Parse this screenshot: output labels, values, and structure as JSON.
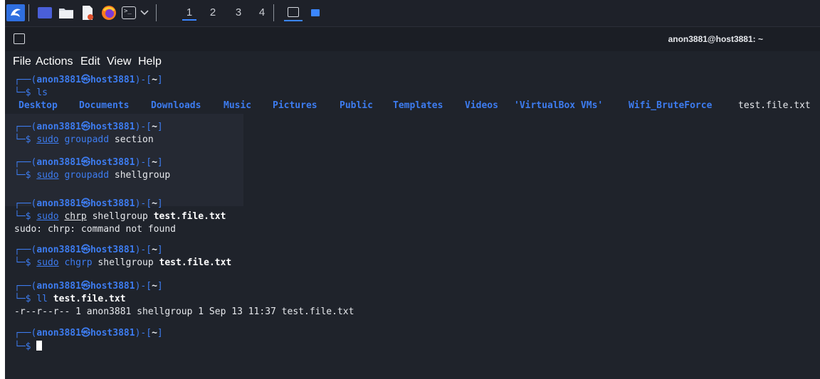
{
  "taskbar": {
    "icons": [
      "kali-dragon-icon",
      "desktop-icon",
      "folder-icon",
      "text-editor-icon",
      "firefox-icon",
      "terminal-icon",
      "chevron-down-icon"
    ],
    "workspaces": [
      "1",
      "2",
      "3",
      "4"
    ],
    "active_workspace": "1"
  },
  "window": {
    "title": "anon3881@host3881: ~"
  },
  "menu": {
    "file": "File",
    "actions": "Actions",
    "edit": "Edit",
    "view": "View",
    "help": "Help"
  },
  "prompt": {
    "open": "┌──(",
    "user": "anon3881",
    "at": "㉿",
    "host": "host3881",
    "close": ")-[",
    "cwd": "~",
    "end": "]",
    "second": "└─",
    "dollar": "$ "
  },
  "commands": {
    "c1": "ls",
    "c2_sudo": "sudo",
    "c2_cmd": "groupadd",
    "c2_arg": " section",
    "c3_sudo": "sudo",
    "c3_cmd": "groupadd",
    "c3_arg": " shellgroup",
    "c4_sudo": "sudo",
    "c4_cmd": "chrp",
    "c4_arg": " shellgroup ",
    "c4_file": "test.file.txt",
    "c5_sudo": "sudo",
    "c5_cmd": "chgrp",
    "c5_arg": " shellgroup ",
    "c5_file": "test.file.txt",
    "c6_cmd": "ll",
    "c6_file": " test.file.txt"
  },
  "ls_output": [
    "Desktop",
    "Documents",
    "Downloads",
    "Music",
    "Pictures",
    "Public",
    "Templates",
    "Videos",
    "'VirtualBox VMs'",
    "Wifi_BruteForce",
    "test.file.txt"
  ],
  "outputs": {
    "error": "sudo: chrp: command not found",
    "ll": "-r--r--r-- 1 anon3881 shellgroup 1 Sep 13 11:37 test.file.txt"
  },
  "colors": {
    "accent": "#3d7cf0",
    "background": "#1f232b",
    "taskbar": "#1e2129"
  }
}
